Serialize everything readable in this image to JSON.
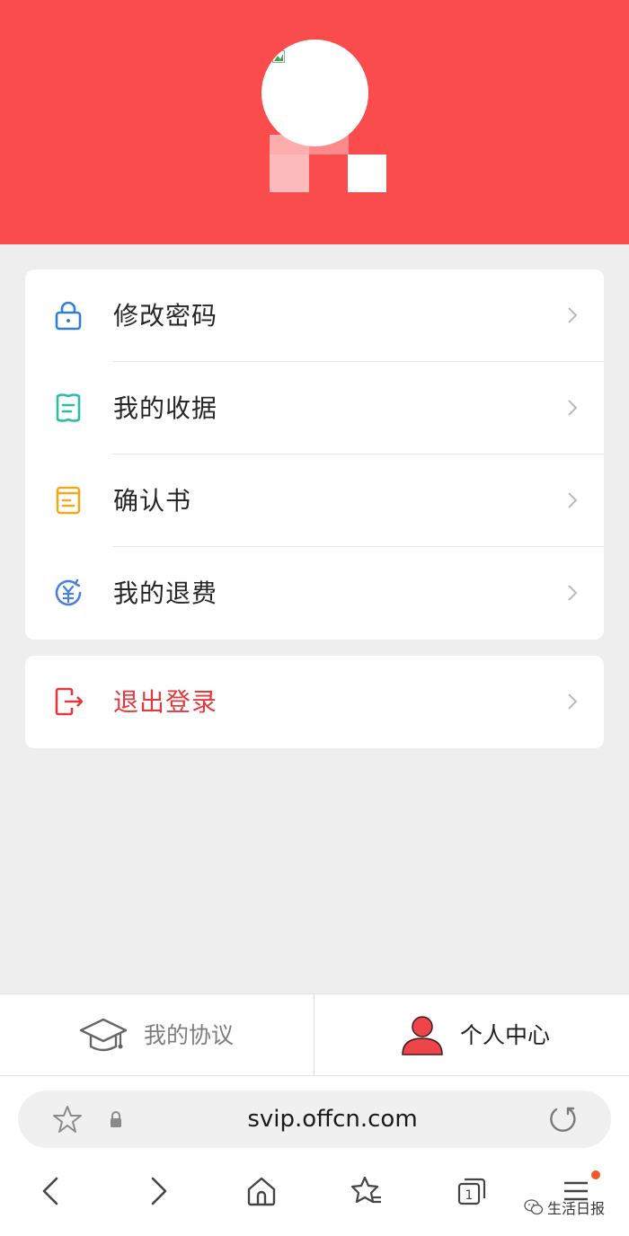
{
  "profile": {
    "avatar_alt": ""
  },
  "menu": {
    "items": [
      {
        "label": "修改密码",
        "icon": "lock-icon",
        "color": "#2f7fd6"
      },
      {
        "label": "我的收据",
        "icon": "receipt-icon",
        "color": "#27bfa6"
      },
      {
        "label": "确认书",
        "icon": "document-icon",
        "color": "#f2a81d"
      },
      {
        "label": "我的退费",
        "icon": "refund-icon",
        "color": "#4a7fe0"
      }
    ],
    "logout": {
      "label": "退出登录",
      "icon": "logout-icon",
      "color": "#e4393c"
    }
  },
  "tabs": {
    "agreement": {
      "label": "我的协议",
      "icon": "graduation-cap-icon",
      "active": false
    },
    "profile": {
      "label": "个人中心",
      "icon": "user-icon",
      "active": true
    }
  },
  "browser": {
    "url": "svip.offcn.com"
  },
  "watermark": {
    "text": "生活日报"
  },
  "colors": {
    "header": "#fa4b4d",
    "background": "#eeeeee",
    "menu_notification_dot": "#f2572c"
  }
}
